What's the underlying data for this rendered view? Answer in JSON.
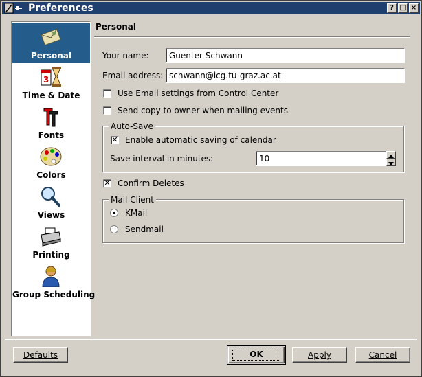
{
  "window": {
    "title": "Preferences",
    "help_button": "?",
    "maximize_button": "□",
    "close_button": "×"
  },
  "sidebar": {
    "items": [
      {
        "label": "Personal",
        "icon": "personal-icon",
        "selected": true
      },
      {
        "label": "Time & Date",
        "icon": "calendar-hourglass-icon",
        "selected": false
      },
      {
        "label": "Fonts",
        "icon": "fonts-icon",
        "selected": false
      },
      {
        "label": "Colors",
        "icon": "palette-icon",
        "selected": false
      },
      {
        "label": "Views",
        "icon": "magnifier-icon",
        "selected": false
      },
      {
        "label": "Printing",
        "icon": "printer-icon",
        "selected": false
      },
      {
        "label": "Group Scheduling",
        "icon": "person-icon",
        "selected": false
      }
    ],
    "selected_color": "#245c8c"
  },
  "page": {
    "title": "Personal",
    "your_name_label": "Your name:",
    "your_name_value": "Guenter Schwann",
    "email_label": "Email address:",
    "email_value": "schwann@icg.tu-graz.ac.at",
    "use_email_settings": {
      "label": "Use Email settings from Control Center",
      "checked": false
    },
    "send_copy": {
      "label": "Send copy to owner when mailing events",
      "checked": false
    },
    "autosave": {
      "title": "Auto-Save",
      "enable": {
        "label": "Enable automatic saving of calendar",
        "checked": true
      },
      "interval_label": "Save interval in minutes:",
      "interval_value": "10"
    },
    "confirm_deletes": {
      "label": "Confirm Deletes",
      "checked": true
    },
    "mail_client": {
      "title": "Mail Client",
      "options": [
        {
          "label": "KMail",
          "selected": true
        },
        {
          "label": "Sendmail",
          "selected": false
        }
      ]
    }
  },
  "buttons": {
    "defaults": "Defaults",
    "ok": "OK",
    "apply": "Apply",
    "cancel": "Cancel"
  },
  "colors": {
    "titlebar": "#1f3f6f",
    "window_bg": "#d4d0c8"
  }
}
